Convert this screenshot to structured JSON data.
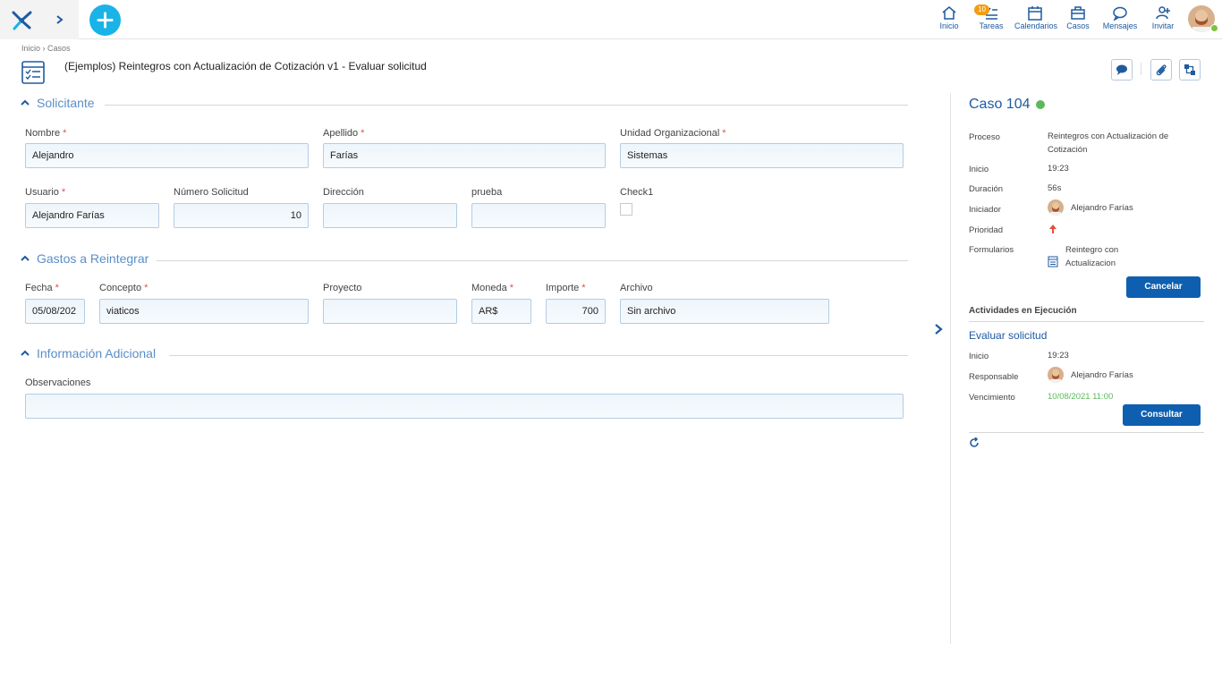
{
  "topbar": {
    "nav": [
      {
        "label": "Inicio",
        "icon": "home-icon"
      },
      {
        "label": "Tareas",
        "icon": "tasks-icon",
        "badge": "10"
      },
      {
        "label": "Calendarios",
        "icon": "calendar-icon"
      },
      {
        "label": "Casos",
        "icon": "briefcase-icon"
      },
      {
        "label": "Mensajes",
        "icon": "chat-icon"
      },
      {
        "label": "Invitar",
        "icon": "invite-user-icon"
      }
    ]
  },
  "header": {
    "breadcrumb": "Inicio › Casos",
    "title": "(Ejemplos) Reintegros con Actualización de Cotización v1 - Evaluar solicitud"
  },
  "sections": {
    "solicitante": "Solicitante",
    "gastos": "Gastos a Reintegrar",
    "info": "Información Adicional"
  },
  "fields": {
    "nombre": {
      "label": "Nombre",
      "value": "Alejandro"
    },
    "apellido": {
      "label": "Apellido",
      "value": "Farías"
    },
    "unidad": {
      "label": "Unidad Organizacional",
      "value": "Sistemas"
    },
    "usuario": {
      "label": "Usuario",
      "value": "Alejandro Farías"
    },
    "numero": {
      "label": "Número Solicitud",
      "value": "10"
    },
    "direccion": {
      "label": "Dirección",
      "value": ""
    },
    "prueba": {
      "label": "prueba",
      "value": ""
    },
    "check1": {
      "label": "Check1",
      "checked": false
    },
    "fecha": {
      "label": "Fecha",
      "value": "05/08/202"
    },
    "concepto": {
      "label": "Concepto",
      "value": "viaticos"
    },
    "proyecto": {
      "label": "Proyecto",
      "value": ""
    },
    "moneda": {
      "label": "Moneda",
      "value": "AR$"
    },
    "importe": {
      "label": "Importe",
      "value": "700"
    },
    "archivo": {
      "label": "Archivo",
      "value": "Sin archivo"
    },
    "observaciones": {
      "label": "Observaciones",
      "value": ""
    }
  },
  "required_mark": "*",
  "case_panel": {
    "title": "Caso 104",
    "status_color": "#5cb85c",
    "proceso_label": "Proceso",
    "proceso_value": "Reintegros con Actualización de Cotización",
    "inicio_label": "Inicio",
    "inicio_value": "19:23",
    "duracion_label": "Duración",
    "duracion_value": "56s",
    "iniciador_label": "Iniciador",
    "iniciador_value": "Alejandro Farías",
    "prioridad_label": "Prioridad",
    "formularios_label": "Formularios",
    "formularios_value": "Reintegro con Actualizacion",
    "cancel_label": "Cancelar",
    "activities_heading": "Actividades en Ejecución",
    "activity_name": "Evaluar solicitud",
    "act_inicio_label": "Inicio",
    "act_inicio_value": "19:23",
    "responsable_label": "Responsable",
    "responsable_value": "Alejandro Farías",
    "vencimiento_label": "Vencimiento",
    "vencimiento_value": "10/08/2021 11:00",
    "consult_label": "Consultar"
  }
}
